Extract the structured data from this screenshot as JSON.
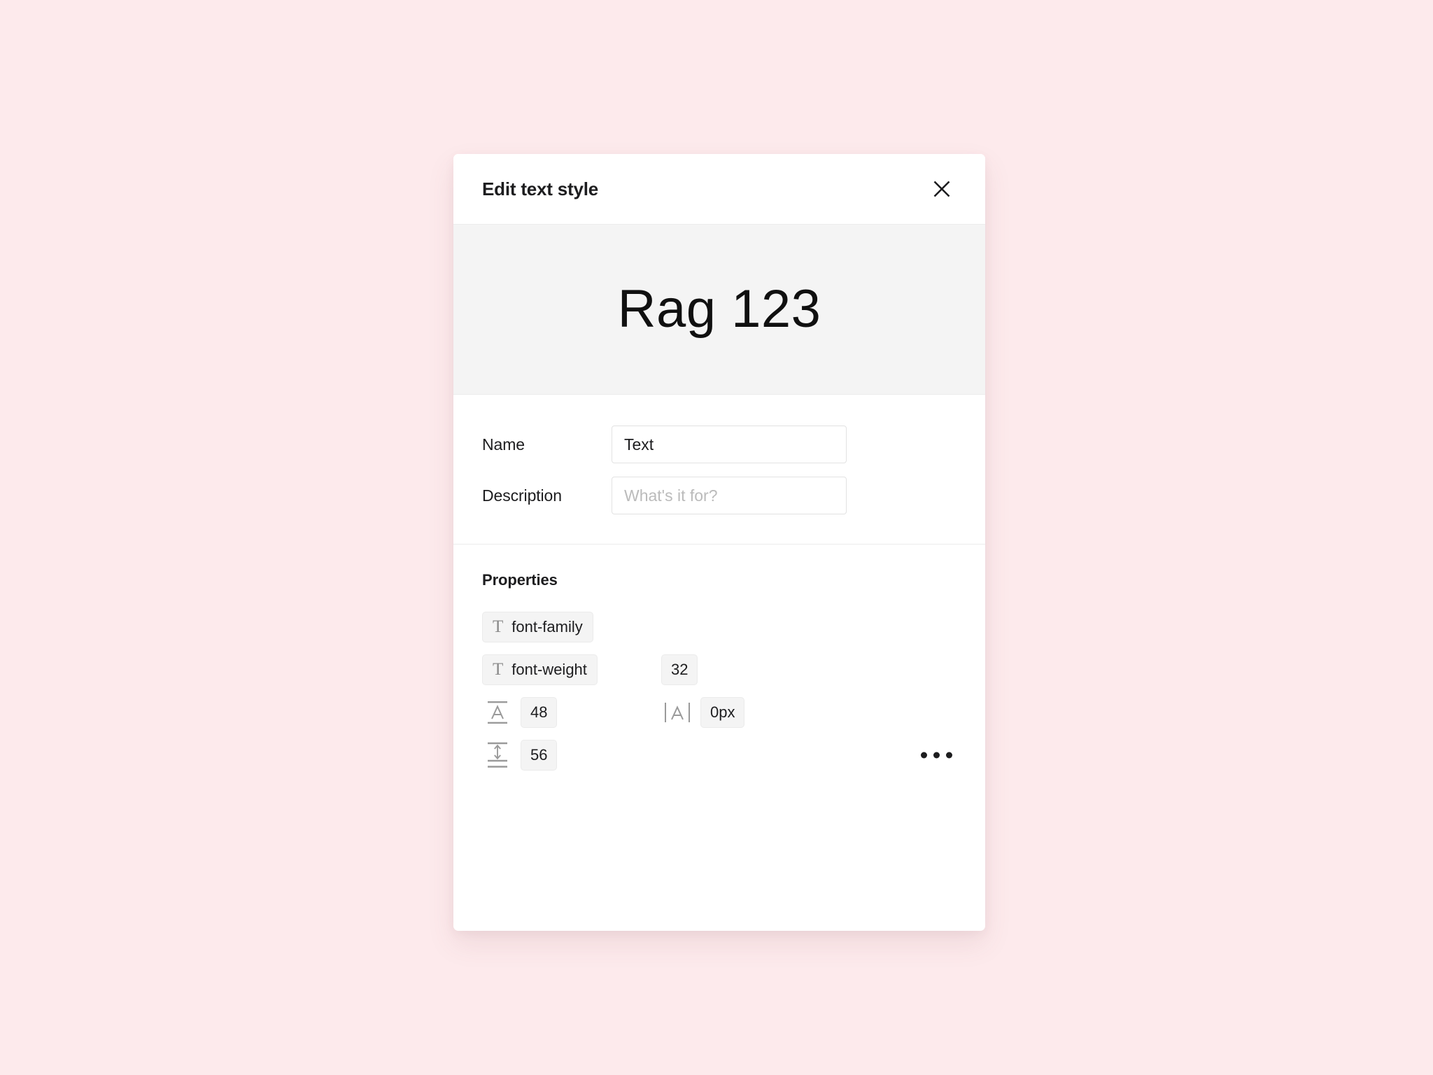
{
  "page": {
    "background_color": "#fdeaec"
  },
  "modal": {
    "title": "Edit text style",
    "close_icon": "close-icon",
    "preview": {
      "sample_text": "Rag 123",
      "background_color": "#f4f4f4"
    },
    "fields": [
      {
        "label": "Name",
        "value": "Text",
        "placeholder": ""
      },
      {
        "label": "Description",
        "value": "",
        "placeholder": "What's it for?"
      }
    ],
    "properties": {
      "heading": "Properties",
      "rows": [
        {
          "left": {
            "kind": "chip",
            "icon": "text-type-icon",
            "glyph": "T",
            "label": "font-family"
          },
          "right": null
        },
        {
          "left": {
            "kind": "chip",
            "icon": "text-type-icon",
            "glyph": "T",
            "label": "font-weight"
          },
          "right": {
            "kind": "value",
            "icon": null,
            "value": "32"
          }
        },
        {
          "left": {
            "kind": "value",
            "icon": "font-size-icon",
            "value": "48"
          },
          "right": {
            "kind": "value",
            "icon": "letter-spacing-icon",
            "value": "0px"
          }
        },
        {
          "left": {
            "kind": "value",
            "icon": "line-height-icon",
            "value": "56"
          },
          "right": {
            "kind": "more",
            "icon": "more-horizontal-icon"
          }
        }
      ]
    }
  }
}
